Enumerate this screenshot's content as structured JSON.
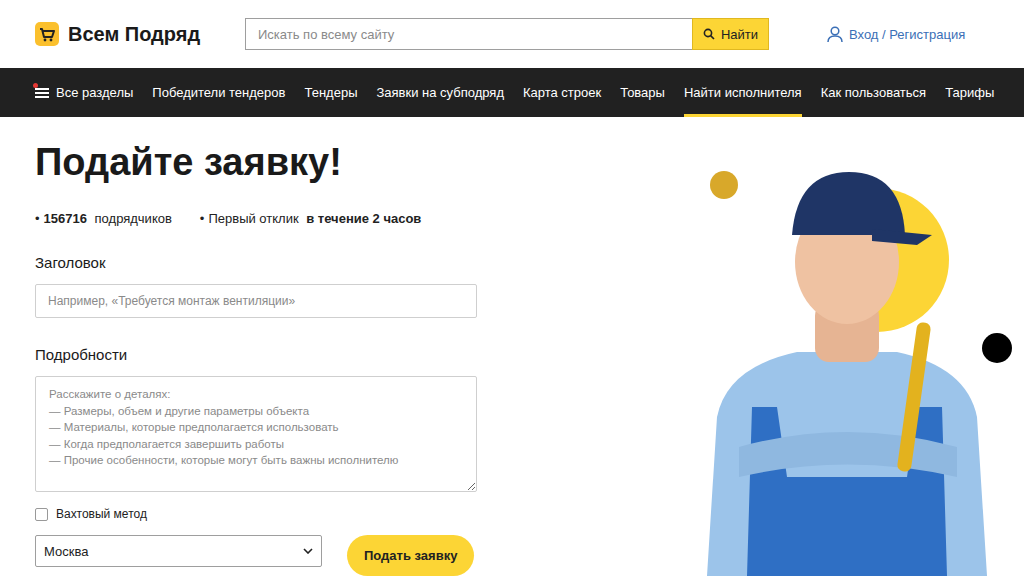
{
  "header": {
    "logo": "Всем Подряд",
    "search": {
      "placeholder": "Искать по всему сайту",
      "button": "Найти"
    },
    "login": "Вход / Регистрация"
  },
  "nav": [
    {
      "label": "Все разделы",
      "selected": false,
      "dot": true
    },
    {
      "label": "Победители тендеров",
      "selected": false,
      "dot": false
    },
    {
      "label": "Тендеры",
      "selected": false,
      "dot": false
    },
    {
      "label": "Заявки на субподряд",
      "selected": false,
      "dot": false
    },
    {
      "label": "Карта строек",
      "selected": false,
      "dot": false
    },
    {
      "label": "Товары",
      "selected": false,
      "dot": false
    },
    {
      "label": "Найти исполнителя",
      "selected": true,
      "dot": false
    },
    {
      "label": "Как пользоваться",
      "selected": false,
      "dot": false
    },
    {
      "label": "Тарифы",
      "selected": false,
      "dot": false
    }
  ],
  "heading": "Подайте заявку!",
  "stats": [
    {
      "bullet": "•",
      "parts": [
        {
          "text": "156716",
          "bold": true
        },
        {
          "text": " подрядчиков",
          "bold": false
        }
      ]
    },
    {
      "bullet": "•",
      "parts": [
        {
          "text": "Первый отклик ",
          "bold": false
        },
        {
          "text": "в течение 2 часов",
          "bold": true
        }
      ]
    }
  ],
  "form": {
    "title": {
      "label": "Заголовок",
      "placeholder": "Например, «Требуется монтаж вентиляции»"
    },
    "details": {
      "label": "Подробности",
      "placeholder": "Расскажите о деталях:\n— Размеры, объем и другие параметры объекта\n— Материалы, которые предполагается использовать\n— Когда предполагается завершить работы\n— Прочие особенности, которые могут быть важны исполнителю"
    },
    "shift": {
      "label": "Вахтовый метод",
      "checked": false
    },
    "city": {
      "value": "Москва"
    },
    "submit": "Подать заявку"
  }
}
